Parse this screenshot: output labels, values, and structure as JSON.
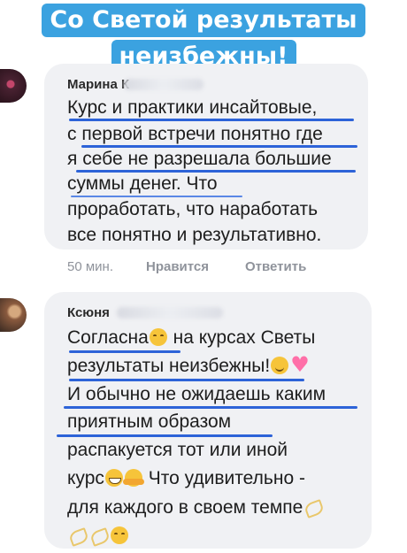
{
  "banner": {
    "line1": "Со Светой результаты",
    "line2": "неизбежны!"
  },
  "colors": {
    "banner_bg": "#3ba2e0",
    "bubble_bg": "#f0f1f4",
    "underline": "#2d63d8",
    "meta_text": "#8f939b"
  },
  "comment1": {
    "author": "Марина К",
    "lines": [
      "Курс и практики инсайтовые,",
      "с первой встречи понятно где",
      "я себе не разрешала большие",
      "суммы денег. Что",
      "проработать, что наработать",
      "все понятно и результативно."
    ],
    "meta": {
      "time": "50 мин.",
      "like": "Нравится",
      "reply": "Ответить"
    }
  },
  "comment2": {
    "author": "Ксюня",
    "lines": [
      "Согласна",
      "на курсах Светы",
      "результаты неизбежны!",
      "И обычно не ожидаешь каким",
      "приятным образом",
      "распакуется тот или иной",
      "курс",
      "Что удивительно -",
      "для каждого в своем темпе"
    ],
    "emoji": [
      "smiling-face",
      "relieved-face",
      "sparkling-heart",
      "grinning-face",
      "hugging-face",
      "dash",
      "dash",
      "dash",
      "smiling-face"
    ]
  }
}
